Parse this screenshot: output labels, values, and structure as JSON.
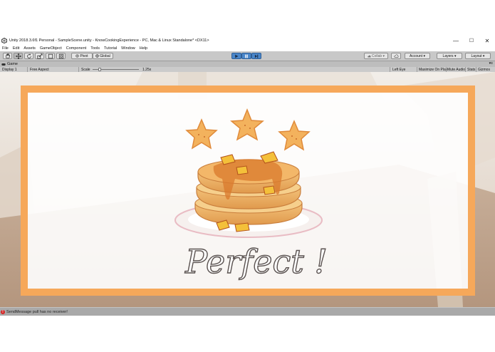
{
  "window": {
    "title": "Unity 2018.3.6f1 Personal - SampleScene.unity - KnowCookingExperience - PC, Mac & Linux Standalone* <DX11>",
    "controls": {
      "minimize": "—",
      "maximize": "☐",
      "close": "✕"
    }
  },
  "menu": [
    "File",
    "Edit",
    "Assets",
    "GameObject",
    "Component",
    "Tools",
    "Tutorial",
    "Window",
    "Help"
  ],
  "toolbar": {
    "pivot": "Pivot",
    "global": "Global",
    "collab": "Collab ▾",
    "account": "Account ▾",
    "layers": "Layers ▾",
    "layout": "Layout ▾"
  },
  "game_tab": {
    "label": "Game",
    "menu": "▾≡"
  },
  "game_controls": {
    "display": "Display 1",
    "aspect": "Free Aspect",
    "scale_label": "Scale",
    "scale_value": "1.25x",
    "left_eye": "Left Eye",
    "maximize_on_play": "Maximize On Play",
    "mute_audio": "Mute Audio",
    "stats": "Stats",
    "gizmos": "Gizmos"
  },
  "game_view": {
    "result_text": "Perfect !",
    "frame_color": "#f6a85a"
  },
  "status": {
    "message": "SendMessage pull has no receiver!",
    "icon": "error-icon"
  }
}
